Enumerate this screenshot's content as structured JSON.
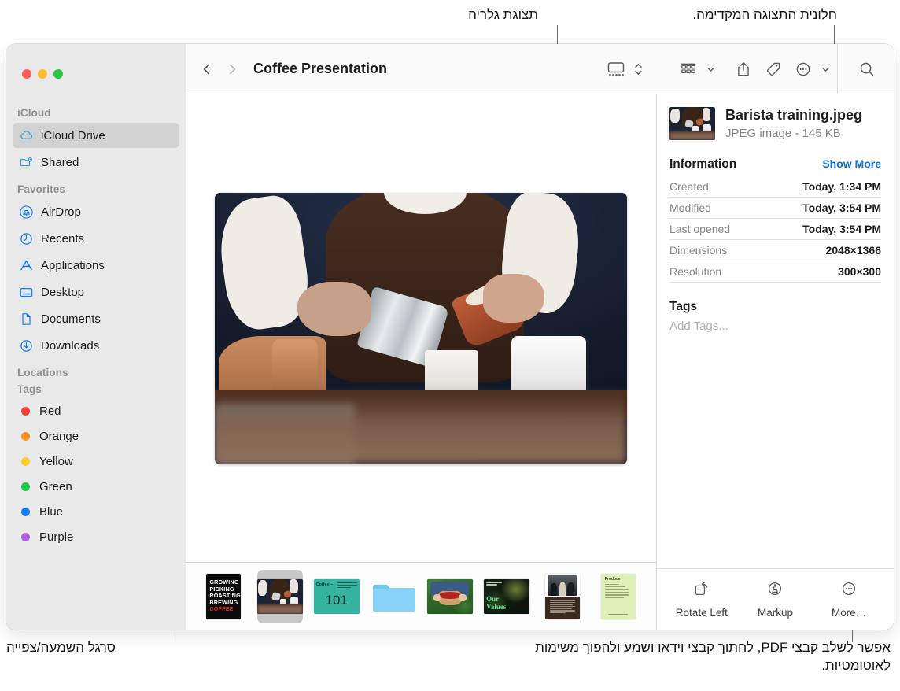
{
  "callouts": {
    "gallery_view": "תצוגת גלריה",
    "preview_pane": "חלונית התצוגה המקדימה.",
    "playback_bar": "סרגל השמעה/צפייה",
    "bottom_right": "אפשר לשלב קבצי PDF, לחתוך קבצי וידאו ושמע ולהפוך משימות לאוטומטיות."
  },
  "window": {
    "traffic_lights": {
      "close": "#ff5f57",
      "minimize": "#febc2e",
      "zoom": "#28c840"
    }
  },
  "toolbar": {
    "back_icon": "chevron-left-icon",
    "forward_icon": "chevron-right-icon",
    "title": "Coffee Presentation",
    "view_gallery_icon": "gallery-view-icon",
    "view_stepper_icon": "up-down-chevron-icon",
    "group_icon": "group-by-icon",
    "group_chevron_icon": "chevron-down-icon",
    "share_icon": "share-icon",
    "tag_icon": "tag-icon",
    "more_icon": "ellipsis-circle-icon",
    "more_chevron_icon": "chevron-down-icon",
    "search_icon": "search-icon"
  },
  "sidebar": {
    "sections": [
      {
        "header": "iCloud",
        "items": [
          {
            "label": "iCloud Drive",
            "icon": "icloud-icon",
            "selected": true
          },
          {
            "label": "Shared",
            "icon": "shared-folder-icon",
            "selected": false
          }
        ]
      },
      {
        "header": "Favorites",
        "items": [
          {
            "label": "AirDrop",
            "icon": "airdrop-icon",
            "selected": false
          },
          {
            "label": "Recents",
            "icon": "clock-icon",
            "selected": false
          },
          {
            "label": "Applications",
            "icon": "applications-icon",
            "selected": false
          },
          {
            "label": "Desktop",
            "icon": "desktop-icon",
            "selected": false
          },
          {
            "label": "Documents",
            "icon": "document-icon",
            "selected": false
          },
          {
            "label": "Downloads",
            "icon": "download-icon",
            "selected": false
          }
        ]
      },
      {
        "header": "Locations",
        "items": []
      },
      {
        "header": "Tags",
        "items": [
          {
            "label": "Red",
            "icon": "tag-dot-icon",
            "color": "#fc3d39"
          },
          {
            "label": "Orange",
            "icon": "tag-dot-icon",
            "color": "#fb9326"
          },
          {
            "label": "Yellow",
            "icon": "tag-dot-icon",
            "color": "#fecb2e"
          },
          {
            "label": "Green",
            "icon": "tag-dot-icon",
            "color": "#1ec84b"
          },
          {
            "label": "Blue",
            "icon": "tag-dot-icon",
            "color": "#0a7cff"
          },
          {
            "label": "Purple",
            "icon": "tag-dot-icon",
            "color": "#b35ee0"
          }
        ]
      }
    ]
  },
  "preview": {
    "image_name": "Barista training.jpeg"
  },
  "filmstrip": {
    "items": [
      {
        "name": "coffee-poster",
        "kind": "poster",
        "selected": false,
        "lines": [
          "GROWING",
          "PICKING",
          "ROASTING",
          "BREWING"
        ],
        "accent_line": "COFFEE"
      },
      {
        "name": "barista-training",
        "kind": "photo",
        "selected": true
      },
      {
        "name": "coffee-101-slide",
        "kind": "slide-teal",
        "selected": false,
        "title": "Coffee –",
        "big": "101"
      },
      {
        "name": "folder",
        "kind": "folder",
        "selected": false
      },
      {
        "name": "berry-harvest-photo",
        "kind": "photo-berries",
        "selected": false
      },
      {
        "name": "our-values-slide",
        "kind": "slide-values",
        "selected": false,
        "big": "Our\nValues"
      },
      {
        "name": "team-document",
        "kind": "doc-people",
        "selected": false
      },
      {
        "name": "green-receipt",
        "kind": "receipt",
        "selected": false,
        "title": "Produce"
      }
    ]
  },
  "inspector": {
    "file_name": "Barista training.jpeg",
    "file_subtitle": "JPEG image - 145 KB",
    "information_title": "Information",
    "show_more": "Show More",
    "rows": [
      {
        "key": "Created",
        "value": "Today, 1:34 PM"
      },
      {
        "key": "Modified",
        "value": "Today, 3:54 PM"
      },
      {
        "key": "Last opened",
        "value": "Today, 3:54 PM"
      },
      {
        "key": "Dimensions",
        "value": "2048×1366"
      },
      {
        "key": "Resolution",
        "value": "300×300"
      }
    ],
    "tags_title": "Tags",
    "add_tags_placeholder": "Add Tags...",
    "actions": [
      {
        "label": "Rotate Left",
        "icon": "rotate-left-icon"
      },
      {
        "label": "Markup",
        "icon": "markup-icon"
      },
      {
        "label": "More…",
        "icon": "ellipsis-circle-icon"
      }
    ]
  },
  "colors": {
    "accent_blue": "#0a6ed6",
    "sidebar_bg": "#e9e9e9",
    "selection_gray": "#d2d2d2"
  }
}
